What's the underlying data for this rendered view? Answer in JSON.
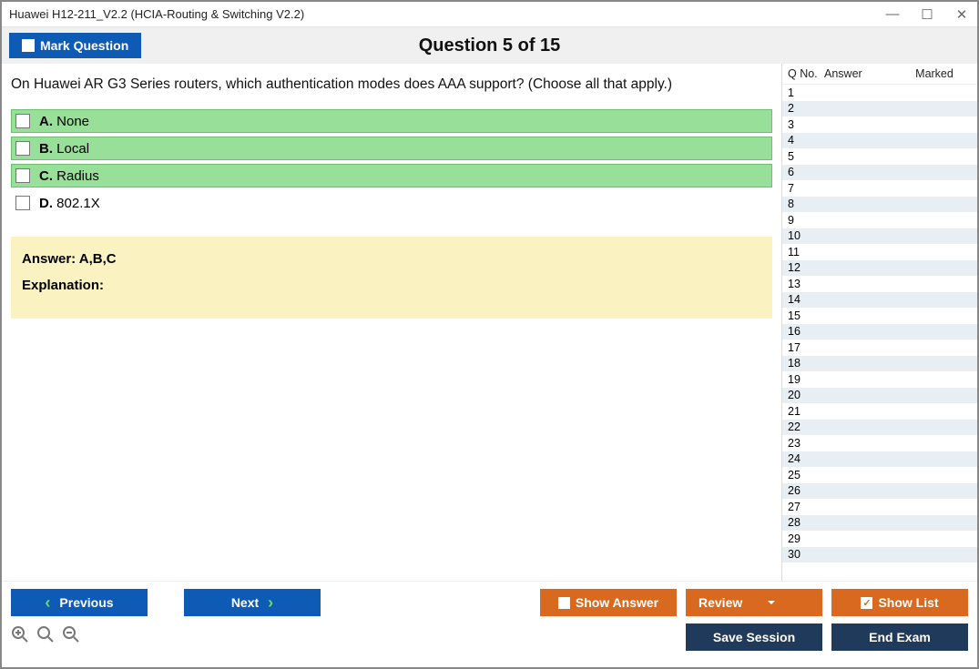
{
  "window": {
    "title": "Huawei H12-211_V2.2 (HCIA-Routing & Switching V2.2)"
  },
  "header": {
    "mark_label": "Mark Question",
    "question_title": "Question 5 of 15"
  },
  "question": {
    "text": "On Huawei AR G3 Series routers, which authentication modes does AAA support? (Choose all that apply.)",
    "options": [
      {
        "letter": "A.",
        "text": "None",
        "correct": true
      },
      {
        "letter": "B.",
        "text": "Local",
        "correct": true
      },
      {
        "letter": "C.",
        "text": "Radius",
        "correct": true
      },
      {
        "letter": "D.",
        "text": "802.1X",
        "correct": false
      }
    ],
    "answer_label": "Answer: A,B,C",
    "explanation_label": "Explanation:"
  },
  "sidebar": {
    "headers": {
      "qno": "Q No.",
      "answer": "Answer",
      "marked": "Marked"
    },
    "rows": [
      {
        "n": "1"
      },
      {
        "n": "2"
      },
      {
        "n": "3"
      },
      {
        "n": "4"
      },
      {
        "n": "5"
      },
      {
        "n": "6"
      },
      {
        "n": "7"
      },
      {
        "n": "8"
      },
      {
        "n": "9"
      },
      {
        "n": "10"
      },
      {
        "n": "11"
      },
      {
        "n": "12"
      },
      {
        "n": "13"
      },
      {
        "n": "14"
      },
      {
        "n": "15"
      },
      {
        "n": "16"
      },
      {
        "n": "17"
      },
      {
        "n": "18"
      },
      {
        "n": "19"
      },
      {
        "n": "20"
      },
      {
        "n": "21"
      },
      {
        "n": "22"
      },
      {
        "n": "23"
      },
      {
        "n": "24"
      },
      {
        "n": "25"
      },
      {
        "n": "26"
      },
      {
        "n": "27"
      },
      {
        "n": "28"
      },
      {
        "n": "29"
      },
      {
        "n": "30"
      }
    ]
  },
  "footer": {
    "previous": "Previous",
    "next": "Next",
    "show_answer": "Show Answer",
    "review": "Review",
    "show_list": "Show List",
    "save_session": "Save Session",
    "end_exam": "End Exam"
  }
}
